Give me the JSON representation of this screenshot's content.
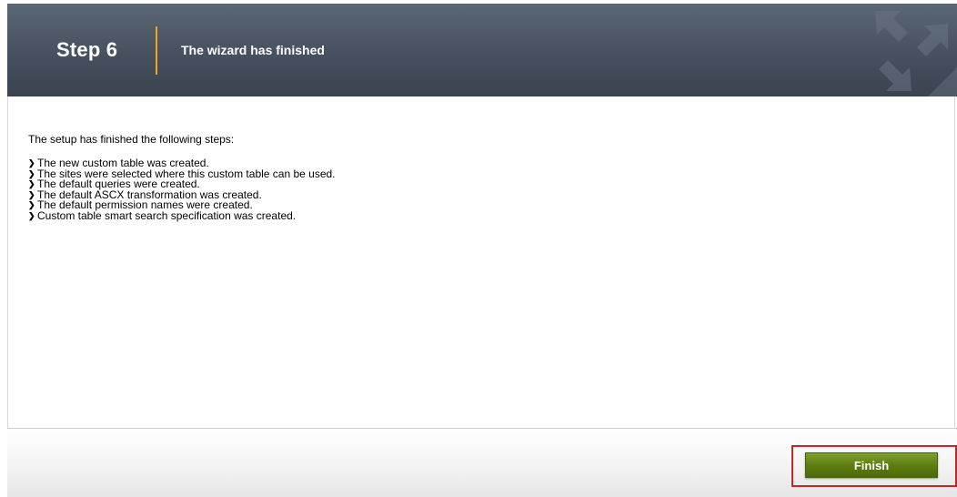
{
  "header": {
    "step_label": "Step 6",
    "title": "The wizard has finished",
    "logo_icon": "arrows-logo-icon"
  },
  "content": {
    "intro": "The setup has finished the following steps:",
    "bullet_icon": "chevron-right-icon",
    "steps": [
      "The new custom table was created.",
      "The sites were selected where this custom table can be used.",
      "The default queries were created.",
      "The default ASCX transformation was created.",
      "The default permission names were created.",
      "Custom table smart search specification was created."
    ]
  },
  "footer": {
    "finish_label": "Finish"
  },
  "colors": {
    "header_bg": "#46505e",
    "divider_accent": "#f0a818",
    "finish_button": "#5d7d12",
    "highlight_border": "#c0282d"
  }
}
